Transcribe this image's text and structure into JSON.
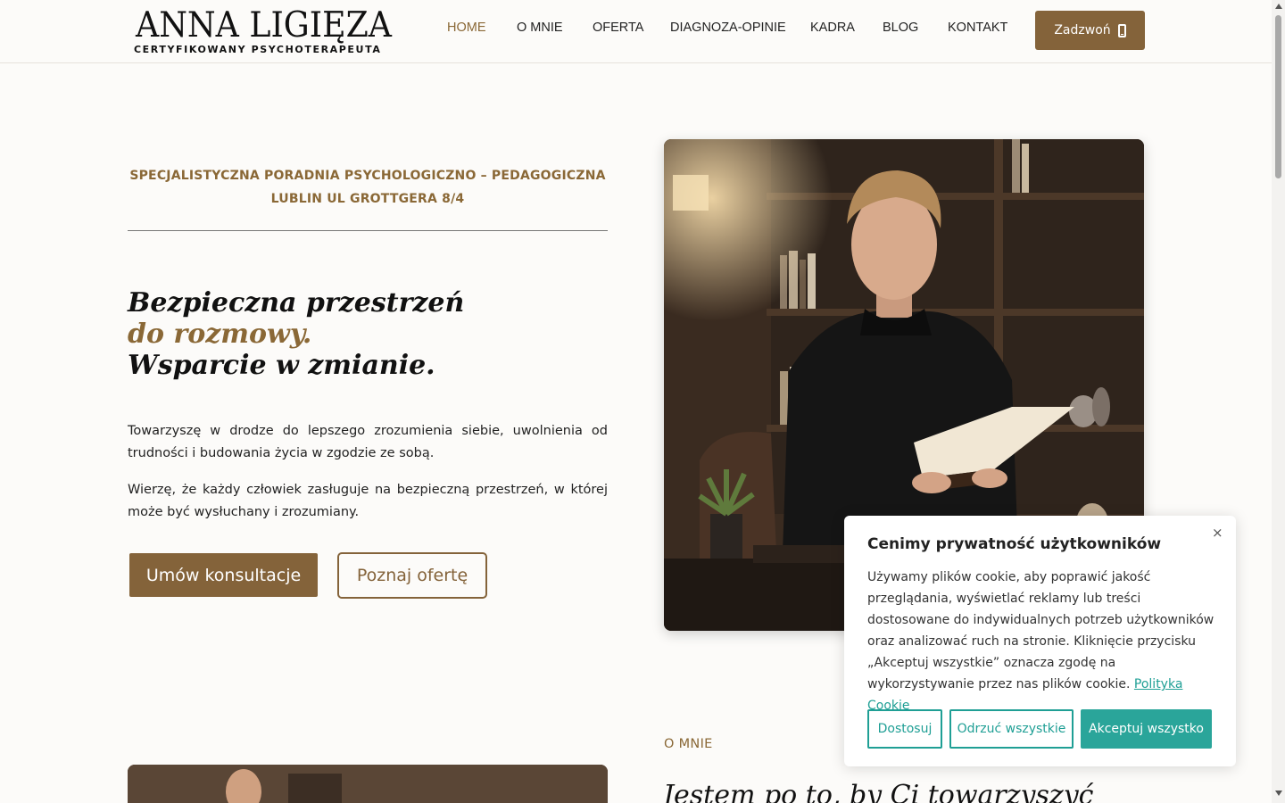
{
  "header": {
    "logo_title": "ANNA LIGIĘZA",
    "logo_subtitle": "CERTYFIKOWANY PSYCHOTERAPEUTA",
    "nav": [
      "HOME",
      "O MNIE",
      "OFERTA",
      "DIAGNOZA-OPINIE",
      "KADRA",
      "BLOG",
      "KONTAKT"
    ],
    "active_nav": "HOME",
    "call_label": "Zadzwoń",
    "call_icon": "phone-icon"
  },
  "hero": {
    "eyebrow_line1": "SPECJALISTYCZNA PORADNIA PSYCHOLOGICZNO – PEDAGOGICZNA",
    "eyebrow_line2": "LUBLIN UL GROTTGERA 8/4",
    "headline_line1": "Bezpieczna przestrzeń",
    "headline_line2": "do rozmowy.",
    "headline_line3": "Wsparcie w zmianie.",
    "para1": "Towarzyszę w drodze do lepszego zrozumienia siebie, uwolnienia od trudności i budowania życia w zgodzie ze sobą.",
    "para2": "Wierzę, że każdy człowiek zasługuje na bezpieczną przestrzeń, w której może być wysłuchany i zrozumiany.",
    "primary_button": "Umów konsultacje",
    "secondary_button": "Poznaj ofertę"
  },
  "about": {
    "label": "O MNIE",
    "title": "Jestem po to, by Ci towarzyszyć"
  },
  "cookie": {
    "title": "Cenimy prywatność użytkowników",
    "text": "Używamy plików cookie, aby poprawić jakość przeglądania, wyświetlać reklamy lub treści dostosowane do indywidualnych potrzeb użytkowników oraz analizować ruch na stronie. Kliknięcie przycisku „Akceptuj wszystkie” oznacza zgodę na wykorzystywanie przez nas plików cookie.",
    "link": "Polityka Cookie",
    "close": "×",
    "btn_customize": "Dostosuj",
    "btn_reject": "Odrzuć wszystkie",
    "btn_accept": "Akceptuj wszystko"
  },
  "colors": {
    "brand": "#84633a",
    "accent_text": "#8a6836",
    "cookie_accent": "#2aa59a",
    "background": "#fcfbf9"
  }
}
